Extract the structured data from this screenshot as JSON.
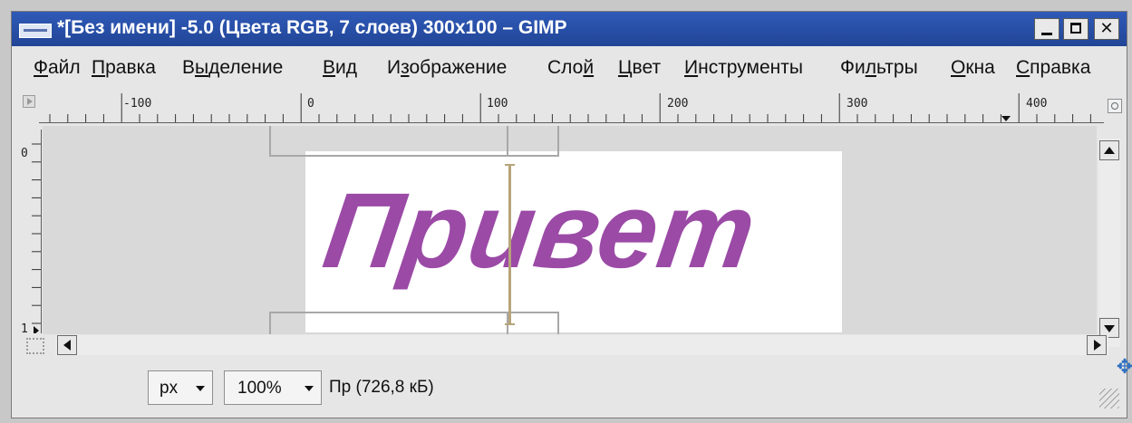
{
  "window": {
    "title": "*[Без имени] -5.0 (Цвета RGB, 7 слоев) 300x100 – GIMP",
    "icons": [
      "gimp-app-icon",
      "minimize-icon",
      "maximize-icon",
      "close-icon"
    ]
  },
  "menu": [
    {
      "pre": "",
      "key": "Ф",
      "post": "айл"
    },
    {
      "pre": "",
      "key": "П",
      "post": "равка"
    },
    {
      "pre": "В",
      "key": "ы",
      "post": "деление"
    },
    {
      "pre": "",
      "key": "В",
      "post": "ид"
    },
    {
      "pre": "И",
      "key": "з",
      "post": "ображение"
    },
    {
      "pre": "Сло",
      "key": "й",
      "post": ""
    },
    {
      "pre": "",
      "key": "Ц",
      "post": "вет"
    },
    {
      "pre": "",
      "key": "И",
      "post": "нструменты"
    },
    {
      "pre": "Фи",
      "key": "л",
      "post": "ьтры"
    },
    {
      "pre": "",
      "key": "О",
      "post": "кна"
    },
    {
      "pre": "",
      "key": "С",
      "post": "правка"
    }
  ],
  "ruler": {
    "h_labels": [
      "-100",
      "0",
      "100",
      "200",
      "300",
      "400"
    ],
    "v_labels": [
      "0",
      "1"
    ]
  },
  "canvas": {
    "text": "Привет",
    "text_color": "#9b4aa6",
    "guide_color": "#b6a57a"
  },
  "status": {
    "unit": "px",
    "zoom": "100%",
    "message": "Пр (726,8 кБ)"
  }
}
